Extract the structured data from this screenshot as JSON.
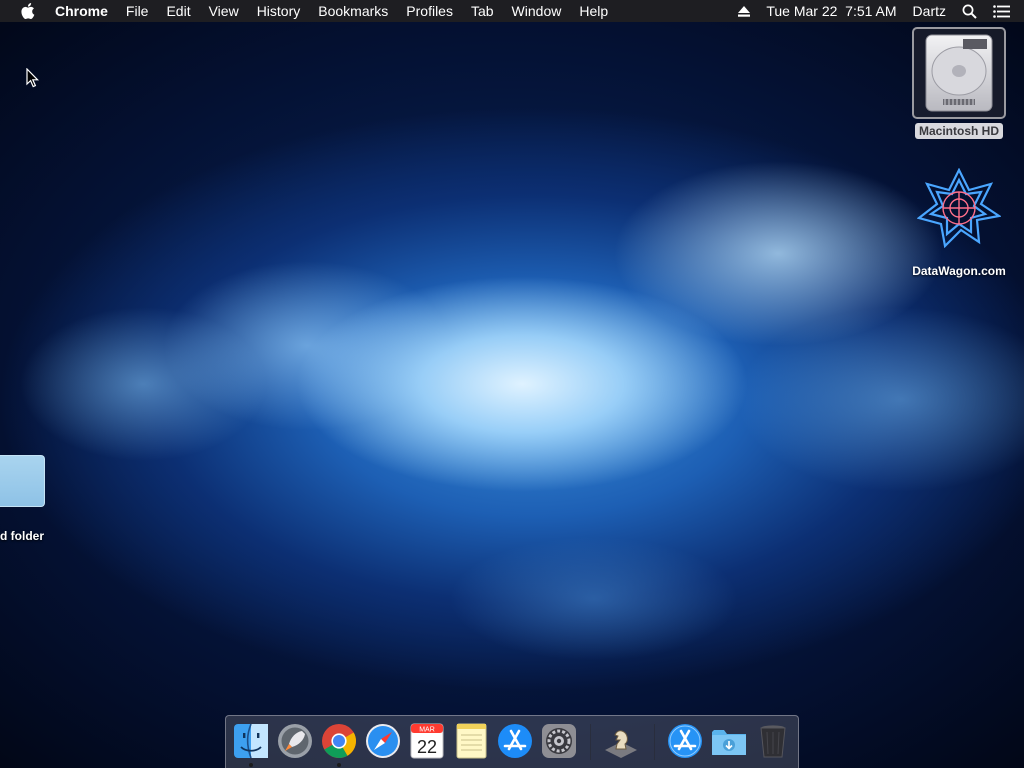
{
  "menubar": {
    "apple_icon": "apple-icon",
    "app_name": "Chrome",
    "items": [
      "File",
      "Edit",
      "View",
      "History",
      "Bookmarks",
      "Profiles",
      "Tab",
      "Window",
      "Help"
    ],
    "status": {
      "eject_icon": "eject-icon",
      "datetime": "Tue Mar 22  7:51 AM",
      "user": "Dartz",
      "search_icon": "spotlight-search-icon",
      "menu_icon": "notification-center-icon"
    }
  },
  "desktop": {
    "icons": [
      {
        "label": "Macintosh HD",
        "icon": "hard-drive-icon"
      },
      {
        "label": "DataWagon.com",
        "icon": "datawagon-logo-icon"
      }
    ],
    "partial_folder_label": "d folder"
  },
  "dock": {
    "apps": [
      {
        "name": "Finder",
        "icon": "finder-icon",
        "running": true
      },
      {
        "name": "Launchpad",
        "icon": "launchpad-icon",
        "running": false
      },
      {
        "name": "Google Chrome",
        "icon": "chrome-icon",
        "running": true
      },
      {
        "name": "Safari",
        "icon": "safari-icon",
        "running": false
      },
      {
        "name": "Calendar",
        "icon": "calendar-icon",
        "running": false,
        "month": "MAR",
        "day": "22"
      },
      {
        "name": "Notes",
        "icon": "notes-icon",
        "running": false
      },
      {
        "name": "App Store",
        "icon": "app-store-icon",
        "running": false
      },
      {
        "name": "System Preferences",
        "icon": "system-preferences-icon",
        "running": false
      },
      {
        "name": "Chess",
        "icon": "chess-icon",
        "running": false
      },
      {
        "name": "Applications",
        "icon": "app-store-folder-icon",
        "running": false
      },
      {
        "name": "Downloads",
        "icon": "downloads-folder-icon",
        "running": false
      },
      {
        "name": "Trash",
        "icon": "trash-icon",
        "running": false
      }
    ]
  },
  "colors": {
    "menubar_bg": "#1e1e22",
    "wallpaper_dark": "#01040f",
    "wallpaper_glow": "#dff2ff"
  }
}
